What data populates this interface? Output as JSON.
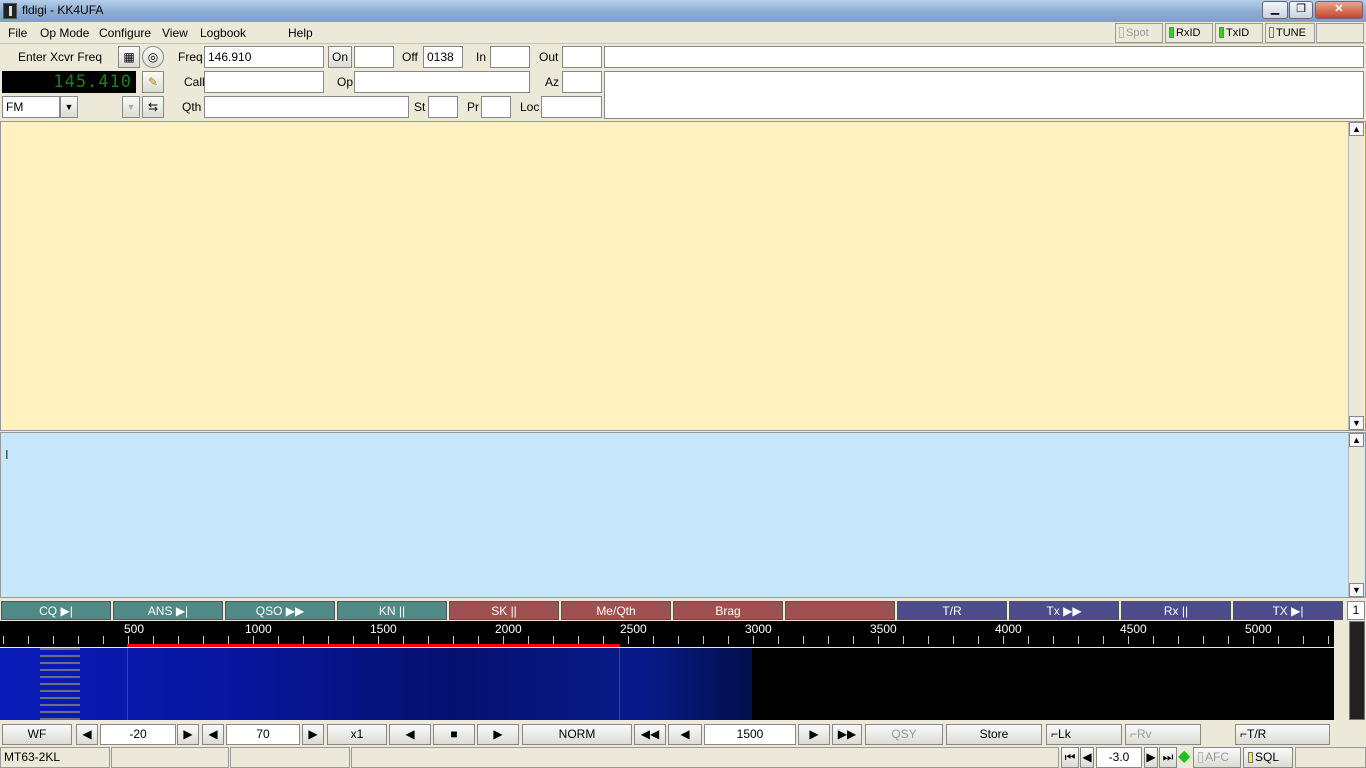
{
  "window": {
    "title": "fldigi - KK4UFA",
    "minimize": "▁",
    "restore": "❐",
    "close": "✕"
  },
  "menu": [
    "File",
    "Op Mode",
    "Configure",
    "View",
    "Logbook",
    "Help"
  ],
  "toolbar": {
    "spot": "Spot",
    "rxid": "RxID",
    "txid": "TxID",
    "tune": "TUNE"
  },
  "xcvr": {
    "enter_label": "Enter Xcvr Freq",
    "display": "145.410",
    "mode": "FM"
  },
  "log": {
    "freq_label": "Freq",
    "freq": "146.910",
    "on_label": "On",
    "on": "",
    "off_label": "Off",
    "off": "0138",
    "in_label": "In",
    "in": "",
    "out_label": "Out",
    "out": "",
    "call_label": "Call",
    "call": "",
    "op_label": "Op",
    "op": "",
    "az_label": "Az",
    "az": "",
    "qth_label": "Qth",
    "qth": "",
    "st_label": "St",
    "st": "",
    "pr_label": "Pr",
    "pr": "",
    "loc_label": "Loc",
    "loc": ""
  },
  "macros": [
    {
      "label": "CQ",
      "glyph": "▶|"
    },
    {
      "label": "ANS",
      "glyph": "▶|"
    },
    {
      "label": "QSO",
      "glyph": "▶▶"
    },
    {
      "label": "KN",
      "glyph": "||"
    },
    {
      "label": "SK",
      "glyph": "||"
    },
    {
      "label": "Me/Qth",
      "glyph": ""
    },
    {
      "label": "Brag",
      "glyph": ""
    },
    {
      "label": "",
      "glyph": ""
    },
    {
      "label": "T/R",
      "glyph": ""
    },
    {
      "label": "Tx",
      "glyph": "▶▶"
    },
    {
      "label": "Rx",
      "glyph": "||"
    },
    {
      "label": "TX",
      "glyph": "▶|"
    }
  ],
  "macro_set": "1",
  "ruler": [
    "500",
    "1000",
    "1500",
    "2000",
    "2500",
    "3000",
    "3500",
    "4000",
    "4500",
    "5000"
  ],
  "controls": {
    "wf": "WF",
    "ref_level": "-20",
    "range": "70",
    "zoom": "x1",
    "norm": "NORM",
    "carrier": "1500",
    "qsy": "QSY",
    "store": "Store",
    "lk": "Lk",
    "rv": "Rv",
    "tr": "T/R"
  },
  "status": {
    "mode": "MT63-2KL",
    "s2n": "-3.0",
    "afc": "AFC",
    "sql": "SQL"
  },
  "colors": {
    "rx_bg": "#fff2c0",
    "tx_bg": "#c7e8fb",
    "freq_text": "#1c7e1c",
    "cursor_band": "#ff0000"
  }
}
